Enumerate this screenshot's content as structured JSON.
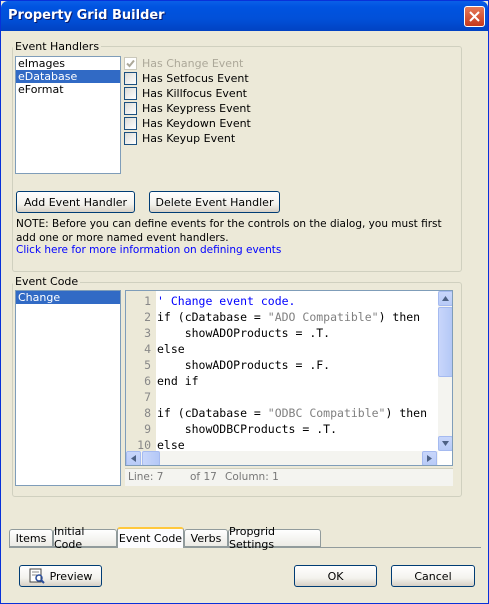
{
  "window": {
    "title": "Property Grid Builder"
  },
  "event_handlers": {
    "group_label": "Event Handlers",
    "list": [
      "eImages",
      "eDatabase",
      "eFormat"
    ],
    "selected_index": 1,
    "checkboxes": [
      {
        "label": "Has Change Event",
        "checked": true,
        "disabled": true
      },
      {
        "label": "Has Setfocus Event",
        "checked": false,
        "disabled": false
      },
      {
        "label": "Has Killfocus Event",
        "checked": false,
        "disabled": false
      },
      {
        "label": "Has Keypress Event",
        "checked": false,
        "disabled": false
      },
      {
        "label": "Has Keydown Event",
        "checked": false,
        "disabled": false
      },
      {
        "label": "Has Keyup Event",
        "checked": false,
        "disabled": false
      }
    ],
    "add_button": "Add Event Handler",
    "delete_button": "Delete Event Handler",
    "note_line1": "NOTE: Before you can define events for the controls on the dialog, you must first",
    "note_line2": "add one or more named event handlers.",
    "link": "Click here for more information on defining events"
  },
  "event_code": {
    "group_label": "Event Code",
    "list": [
      "Change"
    ],
    "selected_index": 0,
    "lines": [
      {
        "n": "1",
        "parts": [
          {
            "t": "' Change event code.",
            "c": "comment"
          }
        ]
      },
      {
        "n": "2",
        "parts": [
          {
            "t": "if (cDatabase = ",
            "c": ""
          },
          {
            "t": "\"ADO Compatible\"",
            "c": "string"
          },
          {
            "t": ") then",
            "c": ""
          }
        ]
      },
      {
        "n": "3",
        "parts": [
          {
            "t": "    showADOProducts = .T.",
            "c": ""
          }
        ]
      },
      {
        "n": "4",
        "parts": [
          {
            "t": "else",
            "c": ""
          }
        ]
      },
      {
        "n": "5",
        "parts": [
          {
            "t": "    showADOProducts = .F.",
            "c": ""
          }
        ]
      },
      {
        "n": "6",
        "parts": [
          {
            "t": "end if",
            "c": ""
          }
        ]
      },
      {
        "n": "7",
        "parts": [
          {
            "t": "",
            "c": ""
          }
        ]
      },
      {
        "n": "8",
        "parts": [
          {
            "t": "if (cDatabase = ",
            "c": ""
          },
          {
            "t": "\"ODBC Compatible\"",
            "c": "string"
          },
          {
            "t": ") then",
            "c": ""
          }
        ]
      },
      {
        "n": "9",
        "parts": [
          {
            "t": "    showODBCProducts = .T.",
            "c": ""
          }
        ]
      },
      {
        "n": "10",
        "parts": [
          {
            "t": "else",
            "c": ""
          }
        ]
      }
    ],
    "status": {
      "line": "Line: 7",
      "of": "of 17",
      "column": "Column: 1"
    }
  },
  "tabs": [
    "Items",
    "Initial Code",
    "Event Code",
    "Verbs",
    "Propgrid Settings"
  ],
  "active_tab": 2,
  "footer": {
    "preview": "Preview",
    "ok": "OK",
    "cancel": "Cancel"
  },
  "colors": {
    "selection": "#316ac5",
    "link": "#0000ff",
    "comment": "#0000ff",
    "string": "#808080"
  }
}
